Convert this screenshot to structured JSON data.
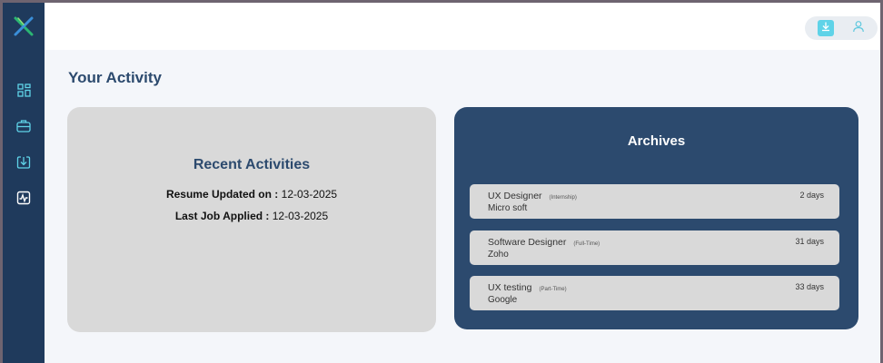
{
  "colors": {
    "sidebar": "#1f3a5c",
    "accent": "#5fd3e8",
    "title": "#2c4a6e",
    "card_gray": "#d9d9d9",
    "card_navy": "#2c4a6e"
  },
  "sidebar": {
    "logo_icon": "x-logo-icon",
    "items": [
      {
        "icon": "dashboard-grid-icon"
      },
      {
        "icon": "briefcase-icon"
      },
      {
        "icon": "download-icon"
      },
      {
        "icon": "activity-icon",
        "active": true
      }
    ]
  },
  "topbar": {
    "download_icon": "download-icon",
    "user_icon": "user-icon"
  },
  "page": {
    "title": "Your Activity"
  },
  "recent": {
    "title": "Recent Activities",
    "resume_label": "Resume Updated on :",
    "resume_date": "12-03-2025",
    "job_label": "Last Job Applied :",
    "job_date": "12-03-2025"
  },
  "archives": {
    "title": "Archives",
    "items": [
      {
        "title": "UX Designer",
        "type": "(Internship)",
        "company": "Micro soft",
        "ago": "2 days"
      },
      {
        "title": "Software Designer",
        "type": "(Full-Time)",
        "company": "Zoho",
        "ago": "31 days"
      },
      {
        "title": "UX testing",
        "type": "(Part-Time)",
        "company": "Google",
        "ago": "33 days"
      }
    ]
  }
}
